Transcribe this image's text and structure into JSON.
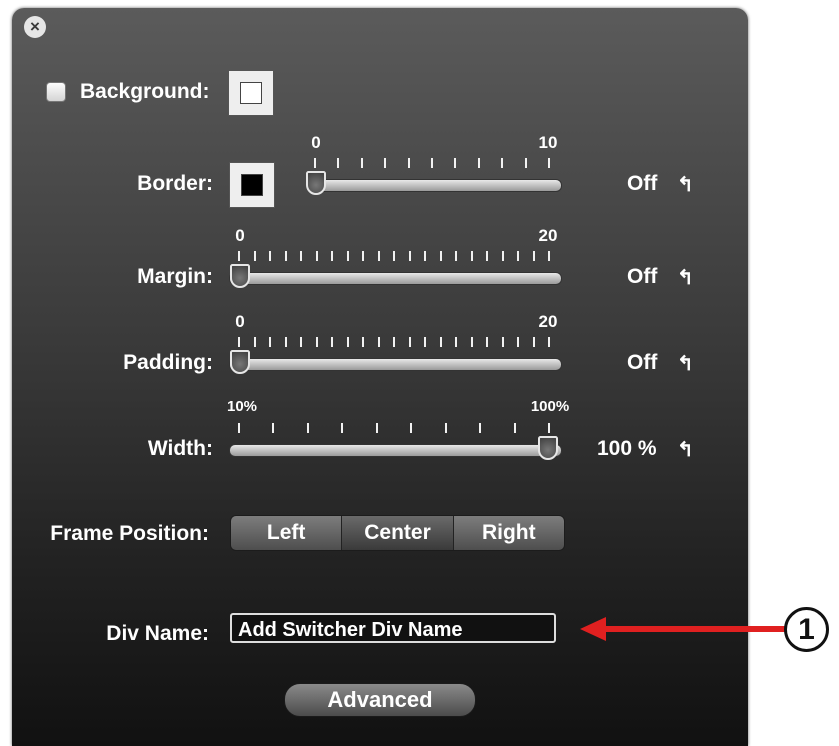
{
  "panel": {
    "close_icon": "close-circle-icon"
  },
  "background": {
    "label": "Background:",
    "checked": false,
    "color": "#ffffff"
  },
  "border": {
    "label": "Border:",
    "color": "#000000",
    "min_label": "0",
    "max_label": "10",
    "level": 0,
    "value": "Off"
  },
  "margin": {
    "label": "Margin:",
    "min_label": "0",
    "max_label": "20",
    "level": 0,
    "value": "Off"
  },
  "padding": {
    "label": "Padding:",
    "min_label": "0",
    "max_label": "20",
    "level": 0,
    "value": "Off"
  },
  "width": {
    "label": "Width:",
    "min_label": "10%",
    "max_label": "100%",
    "level": 1,
    "value": "100 %"
  },
  "frame_position": {
    "label": "Frame Position:",
    "options": [
      "Left",
      "Center",
      "Right"
    ],
    "selected": "Center"
  },
  "div_name": {
    "label": "Div Name:",
    "value": "Add Switcher Div Name"
  },
  "advanced": {
    "label": "Advanced"
  },
  "callout": {
    "number": "1",
    "arrow_color": "#e02020"
  },
  "reset_icon": "undo-arrow-icon"
}
